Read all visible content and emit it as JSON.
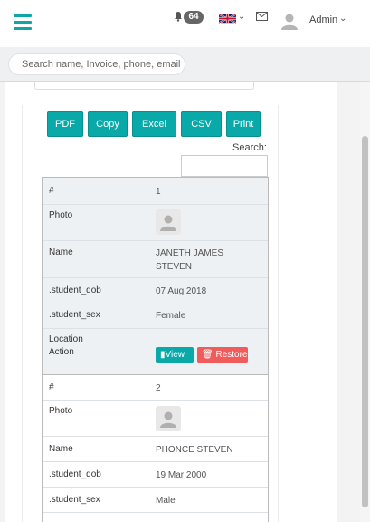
{
  "header": {
    "notification_count": "64",
    "user_name": "Admin",
    "flag_caret": "⌄",
    "admin_caret": "⌄"
  },
  "search": {
    "placeholder": "Search name, Invoice, phone, email"
  },
  "toolbar": {
    "buttons": [
      "PDF",
      "Copy",
      "Excel",
      "CSV",
      "Print"
    ]
  },
  "table": {
    "search_label": "Search:",
    "records": [
      {
        "fields": {
          "num_label": "#",
          "num": "1",
          "photo_label": "Photo",
          "name_label": "Name",
          "name_line1": "JANETH JAMES",
          "name_line2": "STEVEN",
          "dob_label": ".student_dob",
          "dob": "07 Aug 2018",
          "sex_label": ".student_sex",
          "sex": "Female",
          "location_label": "Location",
          "action_label": "Action",
          "view_label": "View",
          "restore_label": "Restore"
        }
      },
      {
        "fields": {
          "num_label": "#",
          "num": "2",
          "photo_label": "Photo",
          "name_label": "Name",
          "name": "PHONCE STEVEN",
          "dob_label": ".student_dob",
          "dob": "19 Mar 2000",
          "sex_label": ".student_sex",
          "sex": "Male"
        }
      }
    ]
  },
  "colors": {
    "accent": "#0aa9a9",
    "danger": "#f05b5b"
  }
}
